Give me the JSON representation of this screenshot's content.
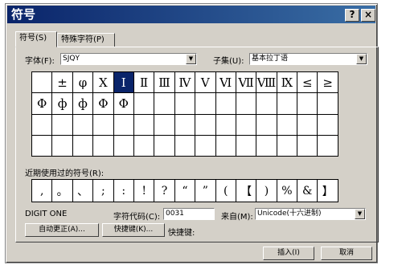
{
  "window": {
    "title": "符号",
    "help_label": "?",
    "close_label": "×"
  },
  "tabs": [
    {
      "label": "符号(S)"
    },
    {
      "label": "特殊字符(P)"
    }
  ],
  "font": {
    "label": "字体(F):",
    "value": "SJQY"
  },
  "subset": {
    "label": "子集(U):",
    "value": "基本拉丁语"
  },
  "symbol_grid": [
    [
      "",
      "±",
      "φ",
      "Ⅹ",
      "Ⅰ",
      "Ⅱ",
      "Ⅲ",
      "Ⅳ",
      "Ⅴ",
      "Ⅵ",
      "Ⅶ",
      "Ⅷ",
      "Ⅸ",
      "≤",
      "≥"
    ],
    [
      "Φ",
      "ф",
      "ф",
      "Φ",
      "Φ",
      "",
      "",
      "",
      "",
      "",
      "",
      "",
      "",
      "",
      ""
    ],
    [
      "",
      "",
      "",
      "",
      "",
      "",
      "",
      "",
      "",
      "",
      "",
      "",
      "",
      "",
      ""
    ],
    [
      "",
      "",
      "",
      "",
      "",
      "",
      "",
      "",
      "",
      "",
      "",
      "",
      "",
      "",
      ""
    ]
  ],
  "selected_symbol": "Ⅰ",
  "recent": {
    "label": "近期使用过的符号(R):",
    "symbols": [
      ",",
      "。",
      "、",
      ";",
      ":",
      "!",
      "?",
      "“",
      "”",
      "(",
      "【",
      ")",
      "%",
      "&",
      "】"
    ]
  },
  "char_name": "DIGIT ONE",
  "char_code": {
    "label": "字符代码(C):",
    "value": "0031"
  },
  "from": {
    "label": "来自(M):",
    "value": "Unicode(十六进制)"
  },
  "buttons": {
    "autocorrect": "自动更正(A)...",
    "shortcut": "快捷键(K)...",
    "shortcut_label": "快捷键:",
    "insert": "插入(I)",
    "cancel": "取消"
  }
}
